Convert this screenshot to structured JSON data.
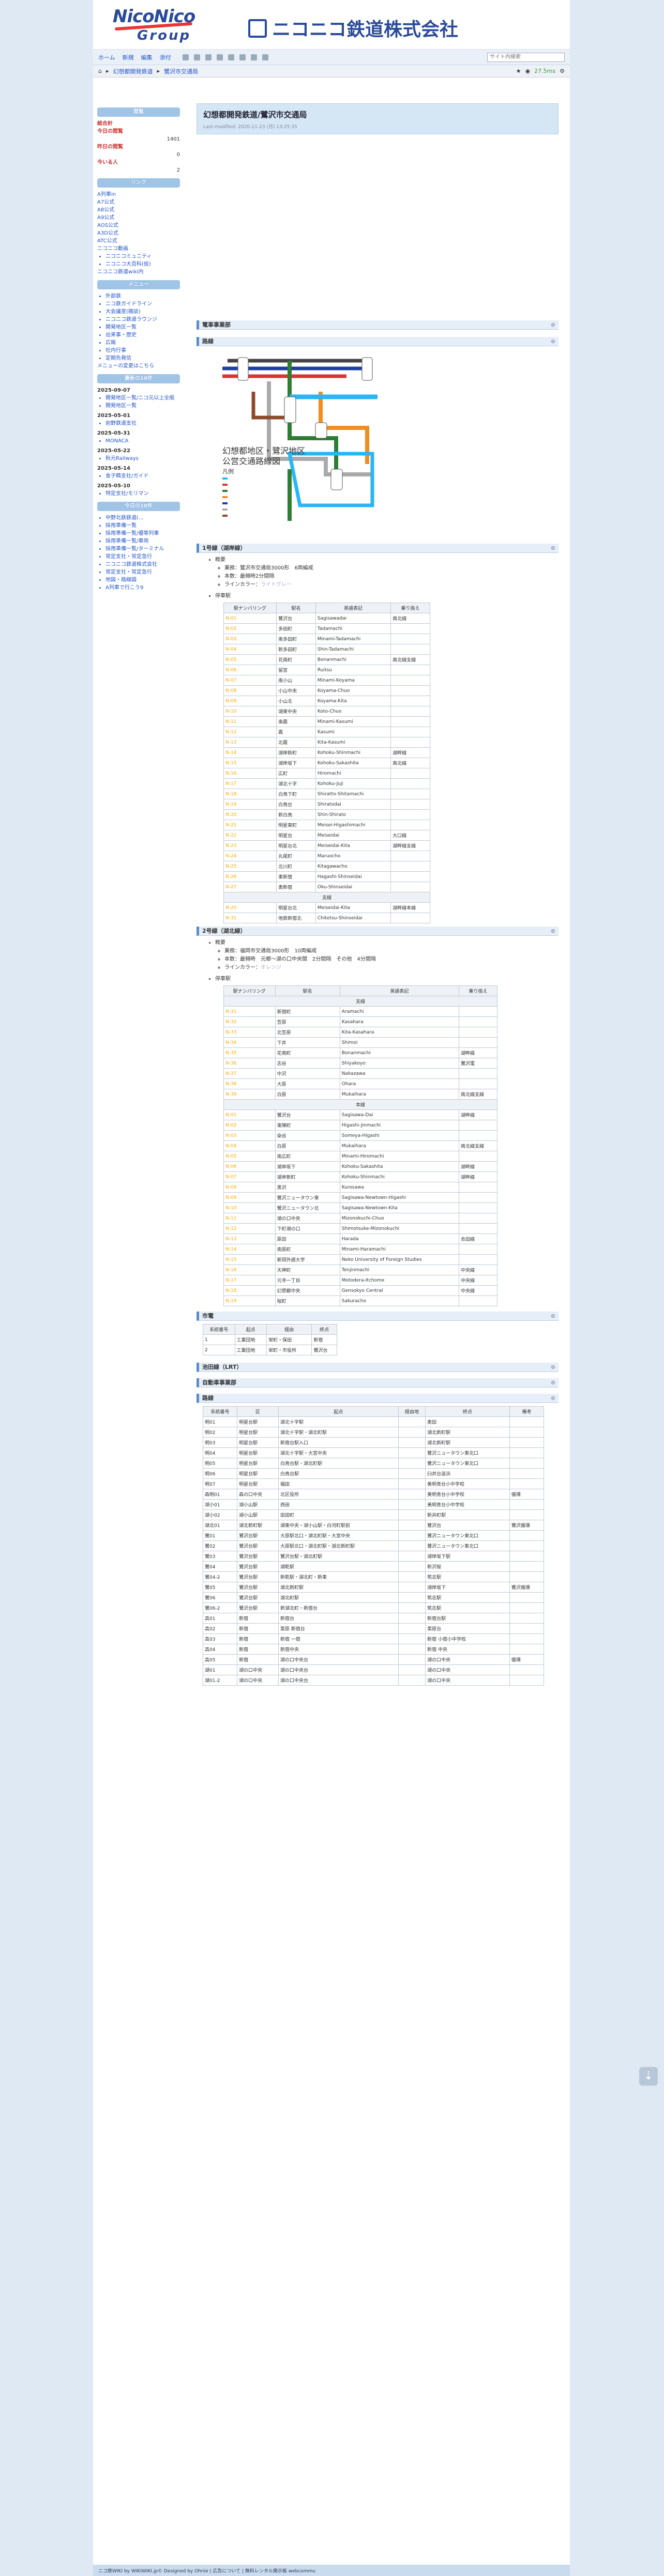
{
  "header": {
    "logo_top": "NicoNico",
    "logo_bottom": "Group",
    "company": "ニコニコ鉄道株式会社"
  },
  "toolbar": {
    "items": [
      "ホーム",
      "新規",
      "編集",
      "添付"
    ],
    "search_placeholder": "サイト内検索"
  },
  "breadcrumb": {
    "items": [
      "幻想都開発鉄道",
      "鷺沢市交通局"
    ],
    "status": "27.5ms"
  },
  "page": {
    "title": "幻想都開発鉄道/鷺沢市交通局",
    "updated": "Last-modified: 2020-11-23 (月) 13:25:35"
  },
  "side": {
    "count_title": "閲覧",
    "counts": [
      {
        "label": "総合計",
        "value": ""
      },
      {
        "label": "今日の閲覧",
        "value": "1401"
      },
      {
        "label": "昨日の閲覧",
        "value": "0"
      },
      {
        "label": "今いる人",
        "value": "2"
      }
    ],
    "link_title": "リンク",
    "links": [
      "A列車in",
      "A7公式",
      "A8公式",
      "A9公式",
      "AOS公式",
      "A3D公式",
      "ATC公式",
      "ニコニコ動画"
    ],
    "link_sub": [
      "ニコニコミュニティ",
      "ニコニコ大百科(仮)"
    ],
    "link_extra": "ニコニコ鉄道wiki内",
    "menu_title": "メニュー",
    "menu": [
      "外部鉄",
      "ニコ鉄ガイドライン",
      "大会議室(雑談)",
      "ニコニコ鉄道ラウンジ",
      "開発地区一覧",
      "出来事・歴史",
      "広報",
      "社内行事",
      "定期先発信"
    ],
    "menu_note": "メニューの変更はこちら",
    "recent_title": "最新の10件",
    "recent": [
      {
        "date": "2025-09-07",
        "items": [
          "開発地区一覧/ニコ元以上全般",
          "開発地区一覧"
        ]
      },
      {
        "date": "2025-05-01",
        "items": [
          "岩野鉄道支社"
        ]
      },
      {
        "date": "2025-05-31",
        "items": [
          "MONACA"
        ]
      },
      {
        "date": "2025-05-22",
        "items": [
          "秋元Railways"
        ]
      },
      {
        "date": "2025-05-14",
        "items": [
          "金子精支社/ガイド"
        ]
      },
      {
        "date": "2025-05-10",
        "items": [
          "特定支社/モリマン"
        ]
      }
    ],
    "today_title": "今日の10件",
    "today": [
      "中野北鉄鉄道(…",
      "採用準備一覧",
      "採用準備一覧/優等列車",
      "採用準備一覧/車両",
      "採用準備一覧/ターミナル",
      "常定支社・常定急行",
      "ニコニコ鉄道株式会社",
      "常定支社・常定急行",
      "地図・路線図",
      "A列車で行こう9"
    ]
  },
  "map": {
    "title": "幻想都地区・鷺沢地区",
    "subtitle": "公営交通路線図",
    "legend": "凡例"
  },
  "line1": {
    "head": "1号線（湖岸線）",
    "overview": "概要",
    "facts": [
      "業務：鷺沢市交通局3000形　6両編成",
      "本数：最頻時2分間隔",
      "ラインカラー："
    ],
    "color_name": "ライトグレー",
    "station_head": "停車駅",
    "cols": [
      "駅ナンバリング",
      "駅名",
      "英語表記",
      "乗り換え"
    ],
    "rows": [
      {
        "n": "N-01",
        "s": "鷺沢台",
        "e": "Sagisawadai",
        "t": "南北線"
      },
      {
        "n": "N-02",
        "s": "多田町",
        "e": "Tadamachi",
        "t": ""
      },
      {
        "n": "N-03",
        "s": "南多田町",
        "e": "Minami-Tadamachi",
        "t": ""
      },
      {
        "n": "N-04",
        "s": "新多田町",
        "e": "Shin-Tadamachi",
        "t": ""
      },
      {
        "n": "N-05",
        "s": "花南町",
        "e": "Bonanmachi",
        "t": "南北線支線"
      },
      {
        "n": "N-06",
        "s": "留宮",
        "e": "Ruitsu",
        "t": ""
      },
      {
        "n": "N-07",
        "s": "南小山",
        "e": "Minami-Koyama",
        "t": ""
      },
      {
        "n": "N-08",
        "s": "小山中央",
        "e": "Koyama-Chuo",
        "t": ""
      },
      {
        "n": "N-09",
        "s": "小山北",
        "e": "Koyama-Kita",
        "t": ""
      },
      {
        "n": "N-10",
        "s": "湖東中央",
        "e": "Koto-Chuo",
        "t": ""
      },
      {
        "n": "N-11",
        "s": "南霞",
        "e": "Minami-Kasumi",
        "t": ""
      },
      {
        "n": "N-12",
        "s": "霞",
        "e": "Kasumi",
        "t": ""
      },
      {
        "n": "N-13",
        "s": "北霞",
        "e": "Kita-Kasumi",
        "t": ""
      },
      {
        "n": "N-14",
        "s": "湖岸新町",
        "e": "Kohoku-Shinmachi",
        "t": "湖畔線"
      },
      {
        "n": "N-15",
        "s": "湖岸坂下",
        "e": "Kohoku-Sakashita",
        "t": "南北線"
      },
      {
        "n": "N-16",
        "s": "広町",
        "e": "Hiromachi",
        "t": ""
      },
      {
        "n": "N-17",
        "s": "湖北十字",
        "e": "Kohoku-Juji",
        "t": ""
      },
      {
        "n": "N-18",
        "s": "白鳥下町",
        "e": "Shiratto-Shitamachi",
        "t": ""
      },
      {
        "n": "N-19",
        "s": "白鳥台",
        "e": "Shiratodai",
        "t": ""
      },
      {
        "n": "N-20",
        "s": "新白鳥",
        "e": "Shin-Shirato",
        "t": ""
      },
      {
        "n": "N-21",
        "s": "明星東町",
        "e": "Meisei-Higashimachi",
        "t": ""
      },
      {
        "n": "N-22",
        "s": "明星台",
        "e": "Meiseidai",
        "t": "大口線"
      },
      {
        "n": "N-23",
        "s": "明星台北",
        "e": "Meiseidai-Kita",
        "t": "湖畔線支線"
      },
      {
        "n": "N-24",
        "s": "丸尾町",
        "e": "Maruocho",
        "t": ""
      },
      {
        "n": "N-25",
        "s": "北川町",
        "e": "Kitagawacho",
        "t": ""
      },
      {
        "n": "N-26",
        "s": "東新宿",
        "e": "Hagashi-Shinseidai",
        "t": ""
      },
      {
        "n": "N-27",
        "s": "奥新宿",
        "e": "Oku-Shinseidai",
        "t": ""
      }
    ],
    "branch_label": "支線",
    "branch": [
      {
        "n": "N-20",
        "s": "明星台北",
        "e": "Meiseidai-Kita",
        "t": "湖畔線本線"
      },
      {
        "n": "N-31",
        "s": "地鉄新宿北",
        "e": "Chitetsu-Shinseidai",
        "t": ""
      }
    ]
  },
  "line2": {
    "head": "2号線（湖北線）",
    "overview": "概要",
    "facts": [
      "業務：福岡市交通局3000形　10両編成",
      "本数：最頻時　元郷〜湖の口中央間　2分間隔　その他　4分間隔",
      "ラインカラー："
    ],
    "color_name": "オレンジ",
    "station_head": "停車駅",
    "cols": [
      "駅ナンバリング",
      "駅名",
      "英語表記",
      "乗り換え"
    ],
    "sec1": "支線",
    "rows1": [
      {
        "n": "N-31",
        "s": "新宿町",
        "e": "Aramachi",
        "t": ""
      },
      {
        "n": "N-32",
        "s": "笠原",
        "e": "Kasahara",
        "t": ""
      },
      {
        "n": "N-33",
        "s": "北笠原",
        "e": "Kita-Kasahara",
        "t": ""
      },
      {
        "n": "N-34",
        "s": "下井",
        "e": "Shimoi",
        "t": ""
      },
      {
        "n": "N-35",
        "s": "花南町",
        "e": "Bonanmachi",
        "t": "湖畔線"
      },
      {
        "n": "N-36",
        "s": "志谷",
        "e": "Shiyakoyo",
        "t": "鷺沢電"
      },
      {
        "n": "N-37",
        "s": "中沢",
        "e": "Nakazawa",
        "t": ""
      },
      {
        "n": "N-38",
        "s": "大原",
        "e": "Ohara",
        "t": ""
      },
      {
        "n": "N-39",
        "s": "白原",
        "e": "Mukaihara",
        "t": "南北線支線"
      }
    ],
    "sec2": "本線",
    "rows2": [
      {
        "n": "N-01",
        "s": "鷺沢台",
        "e": "Sagisawa-Dai",
        "t": "湖畔線"
      },
      {
        "n": "N-02",
        "s": "東陣町",
        "e": "Higashi-Jinmachi",
        "t": ""
      },
      {
        "n": "N-03",
        "s": "染谷",
        "e": "Someya-Higashi",
        "t": ""
      },
      {
        "n": "N-04",
        "s": "白原",
        "e": "Mukaihara",
        "t": "南北線支線"
      },
      {
        "n": "N-05",
        "s": "南広町",
        "e": "Minami-Hiromachi",
        "t": ""
      },
      {
        "n": "N-06",
        "s": "湖岸坂下",
        "e": "Kohoku-Sakashita",
        "t": "湖畔線"
      },
      {
        "n": "N-07",
        "s": "湖岸新町",
        "e": "Kohoku-Shinmachi",
        "t": "湖畔線"
      },
      {
        "n": "N-08",
        "s": "黒沢",
        "e": "Kurosawa",
        "t": ""
      },
      {
        "n": "N-09",
        "s": "鷺沢ニュータウン東",
        "e": "Sagisawa-Newtown-Higashi",
        "t": ""
      },
      {
        "n": "N-10",
        "s": "鷺沢ニュータウン北",
        "e": "Sagisawa-Newtown-Kita",
        "t": ""
      },
      {
        "n": "N-11",
        "s": "湖の口中央",
        "e": "Mizonokuchi-Chuo",
        "t": ""
      },
      {
        "n": "N-12",
        "s": "下町湖の口",
        "e": "Shimotsuke-Mizonokuchi",
        "t": ""
      },
      {
        "n": "N-13",
        "s": "原田",
        "e": "Harada",
        "t": "合田線"
      },
      {
        "n": "N-14",
        "s": "南原町",
        "e": "Minami-Haramachi",
        "t": ""
      },
      {
        "n": "N-15",
        "s": "新岡外語大学",
        "e": "Neko University of Foreign Studies",
        "t": ""
      },
      {
        "n": "N-16",
        "s": "天神町",
        "e": "Tenjinmachi",
        "t": "中央線"
      },
      {
        "n": "N-17",
        "s": "元寺一丁目",
        "e": "Motodera-Itchome",
        "t": "中央線"
      },
      {
        "n": "N-18",
        "s": "幻想都中央",
        "e": "Gensokyo Central",
        "t": "中央線"
      },
      {
        "n": "N-19",
        "s": "桜町",
        "e": "Sakuracho",
        "t": ""
      }
    ]
  },
  "tram": {
    "head": "市電",
    "cols": [
      "系統番号",
      "起点",
      "経由",
      "終点"
    ],
    "rows": [
      [
        "1",
        "工業団地",
        "栄町・保田",
        "新宿"
      ],
      [
        "2",
        "工業団地",
        "栄町・市役所",
        "鷺沢台"
      ]
    ]
  },
  "new_line": {
    "head": "池田線（LRT）"
  },
  "bus_section": {
    "head": "自動車事業部"
  },
  "bus": {
    "head": "路線",
    "cols": [
      "系統番号",
      "区",
      "起点",
      "経由地",
      "終点",
      "備考"
    ],
    "rows": [
      [
        "明01",
        "明星台駅",
        "湖北十字駅",
        "",
        "奥田",
        ""
      ],
      [
        "明02",
        "明星台駅",
        "湖北十字駅・湖北町駅",
        "",
        "湖北新町駅",
        ""
      ],
      [
        "明03",
        "明星台駅",
        "新宿台駅入口",
        "",
        "湖北新町駅",
        ""
      ],
      [
        "明04",
        "明星台駅",
        "湖北十字駅・大宮中央",
        "",
        "鷺沢ニュータウン東北口",
        ""
      ],
      [
        "明05",
        "明星台駅",
        "白鳥台駅・湖北町駅",
        "",
        "鷺沢ニュータウン東北口",
        ""
      ],
      [
        "明06",
        "明星台駅",
        "白鳥台駅",
        "",
        "臼井台追浜",
        ""
      ],
      [
        "明07",
        "明星台駅",
        "福田",
        "",
        "美明青台小中学校",
        ""
      ],
      [
        "森明01",
        "森の口中央",
        "北区役所",
        "",
        "美明青台小中学校",
        "循環"
      ],
      [
        "湖小01",
        "湖小山駅",
        "西田",
        "",
        "美明青台小中学校",
        ""
      ],
      [
        "湖小02",
        "湖小山駅",
        "田田町",
        "",
        "新井町駅",
        ""
      ],
      [
        "湖北01",
        "湖北新町駅",
        "湖東中央・湖小山駅・白河町駅前",
        "",
        "鷺沢台",
        "鷺沢循環"
      ],
      [
        "鷺01",
        "鷺沢台駅",
        "大原駅北口・湖北町駅・大宮中央",
        "",
        "鷺沢ニュータウン東北口",
        ""
      ],
      [
        "鷺02",
        "鷺沢台駅",
        "大原駅北口・湖北町駅・湖北新町駅",
        "",
        "鷺沢ニュータウン東北口",
        ""
      ],
      [
        "鷺03",
        "鷺沢台駅",
        "鷺沢台駅・湖北町駅",
        "",
        "湖岸坂下駅",
        ""
      ],
      [
        "鷺04",
        "鷺沢台駅",
        "湖乾駅",
        "",
        "新沢桜",
        ""
      ],
      [
        "鷺04-2",
        "鷺沢台駅",
        "新乾駅・湖北町・新東",
        "",
        "筑志駅",
        ""
      ],
      [
        "鷺05",
        "鷺沢台駅",
        "湖北新町駅",
        "",
        "湖岸坂下",
        "鷺沢循環"
      ],
      [
        "鷺06",
        "鷺沢台駅",
        "湖北町駅",
        "",
        "筑志駅",
        ""
      ],
      [
        "鷺06-2",
        "鷺沢台駅",
        "新湖北町・新宿台",
        "",
        "筑志駅",
        ""
      ],
      [
        "高01",
        "新宿",
        "新宿台",
        "",
        "新宿台駅",
        ""
      ],
      [
        "高02",
        "新宿",
        "菜原 新宿台",
        "",
        "菜原台",
        ""
      ],
      [
        "高03",
        "新宿",
        "新宿 一宿",
        "",
        "新宿 小宿小中学校",
        ""
      ],
      [
        "高04",
        "新宿",
        "新宿中央",
        "",
        "新宿 中央",
        ""
      ],
      [
        "高05",
        "新宿",
        "湖の口中央台",
        "",
        "湖の口中央",
        "循環"
      ],
      [
        "湖01",
        "湖の口中央",
        "湖の口中央台",
        "",
        "湖の口中央",
        ""
      ],
      [
        "湖01-2",
        "湖の口中央",
        "湖の口中央台",
        "",
        "湖の口中央",
        ""
      ]
    ]
  },
  "footer": {
    "text": "ニコ鉄WIKI by  WIKIWIKI.jp©   Designed by  Ohnie   |   広告について   |   無料レンタル掲示板  webcommu"
  }
}
